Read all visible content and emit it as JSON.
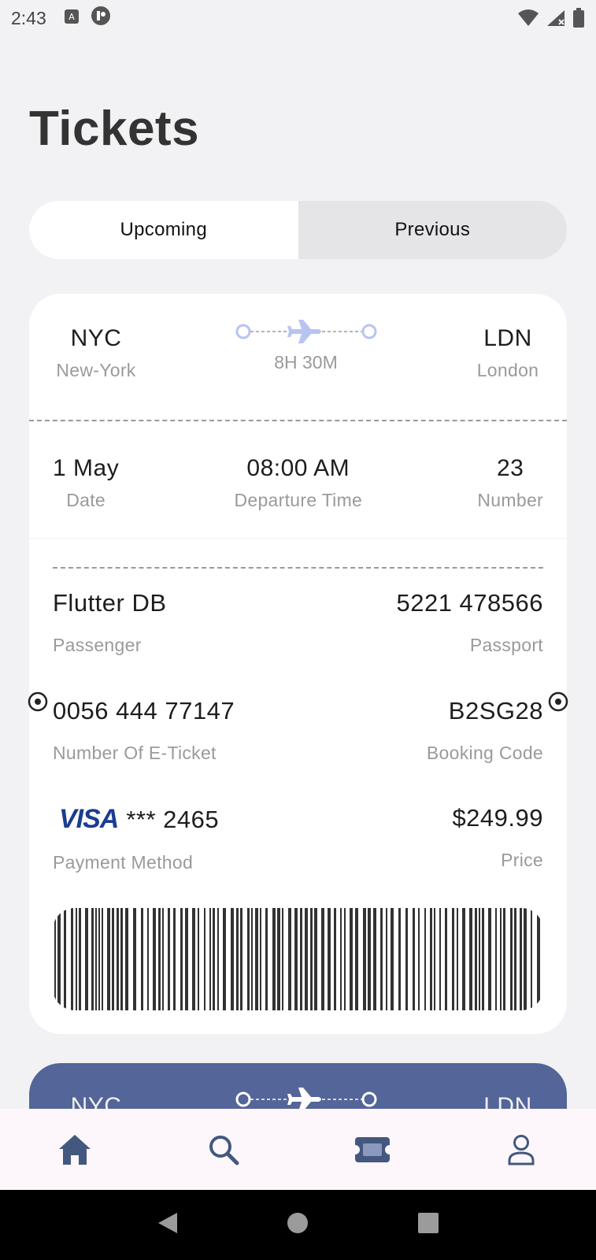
{
  "status_bar": {
    "time": "2:43"
  },
  "page": {
    "title": "Tickets"
  },
  "tabs": [
    {
      "label": "Upcoming",
      "active": true
    },
    {
      "label": "Previous",
      "active": false
    }
  ],
  "ticket": {
    "from": {
      "code": "NYC",
      "city": "New-York"
    },
    "to": {
      "code": "LDN",
      "city": "London"
    },
    "duration": "8H 30M",
    "date": {
      "value": "1 May",
      "label": "Date"
    },
    "departure": {
      "value": "08:00 AM",
      "label": "Departure Time"
    },
    "number": {
      "value": "23",
      "label": "Number"
    },
    "passenger": {
      "value": "Flutter DB",
      "label": "Passenger"
    },
    "passport": {
      "value": "5221 478566",
      "label": "Passport"
    },
    "eticket": {
      "value": "0056 444 77147",
      "label": "Number Of E-Ticket"
    },
    "booking": {
      "value": "B2SG28",
      "label": "Booking Code"
    },
    "payment": {
      "brand": "VISA",
      "value": "*** 2465",
      "label": "Payment Method"
    },
    "price": {
      "value": "$249.99",
      "label": "Price"
    }
  },
  "ticket_next": {
    "from": {
      "code": "NYC"
    },
    "to": {
      "code": "LDN"
    }
  },
  "colors": {
    "accent_light": "#b8c4f0",
    "accent_dark": "#536599",
    "nav_icon": "#44587f"
  },
  "bottom_nav": [
    {
      "icon": "home-icon"
    },
    {
      "icon": "search-icon"
    },
    {
      "icon": "ticket-icon"
    },
    {
      "icon": "profile-icon"
    }
  ]
}
